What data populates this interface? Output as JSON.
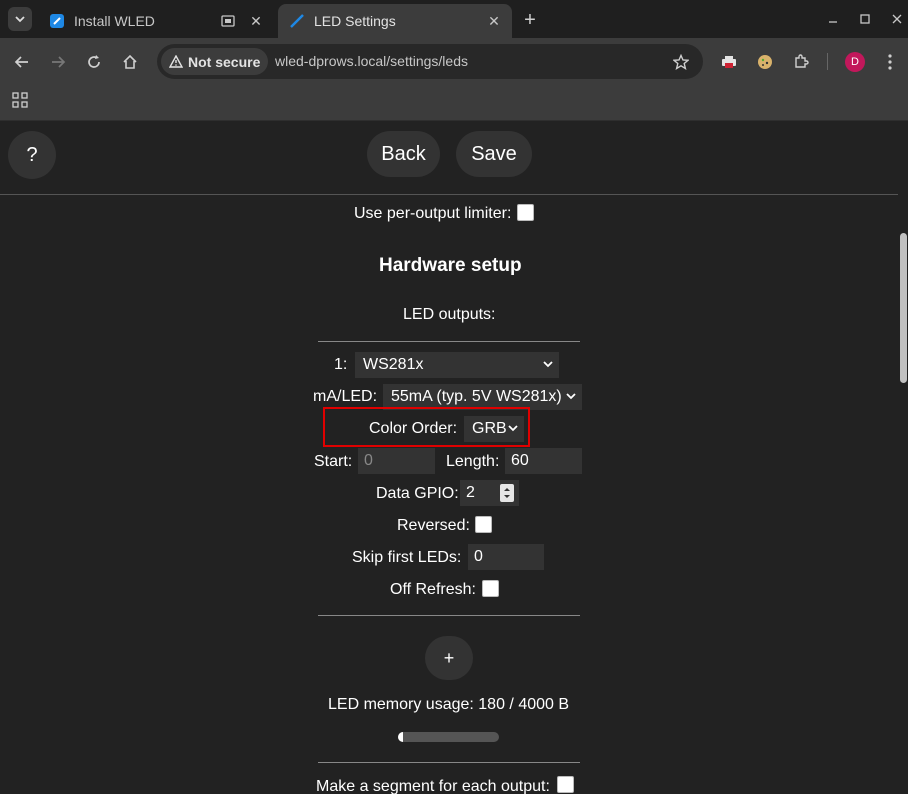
{
  "browser": {
    "tabs": [
      {
        "title": "Install WLED",
        "active": false
      },
      {
        "title": "LED Settings",
        "active": true
      }
    ],
    "address": {
      "security_label": "Not secure",
      "url": "wled-dprows.local/settings/leds"
    },
    "profile_initial": "D"
  },
  "header": {
    "help_label": "?",
    "back_label": "Back",
    "save_label": "Save"
  },
  "settings": {
    "per_output_limiter_label": "Use per-output limiter:",
    "hardware_heading": "Hardware setup",
    "led_outputs_label": "LED outputs:",
    "output": {
      "index_label": "1:",
      "type_value": "WS281x",
      "ma_label": "mA/LED:",
      "ma_value": "55mA (typ. 5V WS281x)",
      "color_order_label": "Color Order:",
      "color_order_value": "GRB",
      "start_label": "Start:",
      "start_placeholder": "0",
      "length_label": "Length:",
      "length_value": "60",
      "gpio_label": "Data GPIO:",
      "gpio_value": "2",
      "reversed_label": "Reversed:",
      "skip_label": "Skip first LEDs:",
      "skip_value": "0",
      "off_refresh_label": "Off Refresh:"
    },
    "add_output_label": "+",
    "memory_label": "LED memory usage: 180 / 4000 B",
    "memory_fraction": 0.045,
    "segment_label": "Make a segment for each output:"
  },
  "colors": {
    "page_bg": "#222222",
    "control_bg": "#333333",
    "highlight": "#e00000"
  }
}
